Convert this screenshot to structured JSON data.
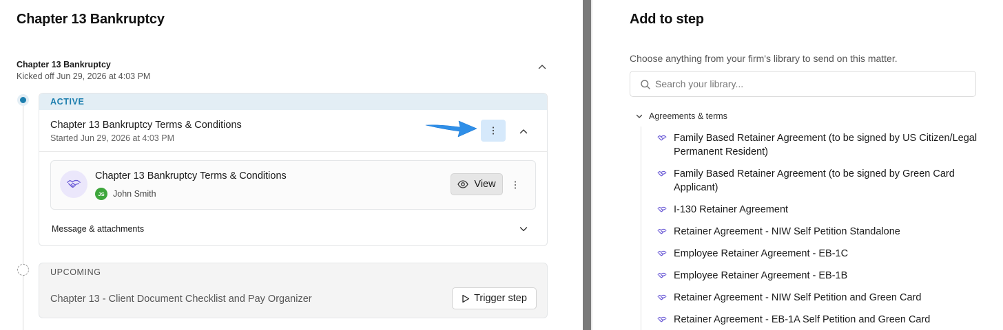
{
  "left": {
    "page_title": "Chapter 13 Bankruptcy",
    "flow": {
      "title": "Chapter 13 Bankruptcy",
      "subtitle": "Kicked off Jun 29, 2026 at 4:03 PM"
    },
    "active_step": {
      "status": "ACTIVE",
      "title": "Chapter 13 Bankruptcy Terms & Conditions",
      "subtitle": "Started Jun 29, 2026 at 4:03 PM",
      "document": {
        "title": "Chapter 13 Bankruptcy Terms & Conditions",
        "assignee_initials": "JS",
        "assignee_name": "John Smith",
        "view_label": "View"
      },
      "message_label": "Message & attachments"
    },
    "upcoming_step": {
      "status": "UPCOMING",
      "title": "Chapter 13 - Client Document Checklist and Pay Organizer",
      "trigger_label": "Trigger step"
    }
  },
  "right": {
    "title": "Add to step",
    "description": "Choose anything from your firm's library to send on this matter.",
    "search_placeholder": "Search your library...",
    "category": "Agreements & terms",
    "items": [
      {
        "label": "Family Based Retainer Agreement (to be signed by US Citizen/Legal Permanent Resident)"
      },
      {
        "label": "Family Based Retainer Agreement (to be signed by Green Card Applicant)"
      },
      {
        "label": "I-130 Retainer Agreement"
      },
      {
        "label": "Retainer Agreement - NIW Self Petition Standalone"
      },
      {
        "label": "Employee Retainer Agreement - EB-1C"
      },
      {
        "label": "Employee Retainer Agreement - EB-1B"
      },
      {
        "label": "Retainer Agreement - NIW Self Petition and Green Card"
      },
      {
        "label": "Retainer Agreement - EB-1A Self Petition and Green Card"
      }
    ]
  },
  "colors": {
    "accent": "#1c7eae",
    "active_bg": "#e3eef5",
    "kebab_highlight": "#d6e9fb",
    "arrow": "#2f8fe8",
    "agreement_icon": "#6b5bd6",
    "avatar": "#3ea63c"
  },
  "icons": {
    "flow_collapse": "chevron-up-icon",
    "step_menu": "more-vertical-icon",
    "step_collapse": "chevron-up-icon",
    "document": "handshake-icon",
    "view": "eye-icon",
    "message_expand": "chevron-down-icon",
    "trigger": "play-icon",
    "search": "search-icon",
    "category_toggle": "chevron-down-icon",
    "agreement": "handshake-icon",
    "annotation": "arrow-right-icon"
  }
}
